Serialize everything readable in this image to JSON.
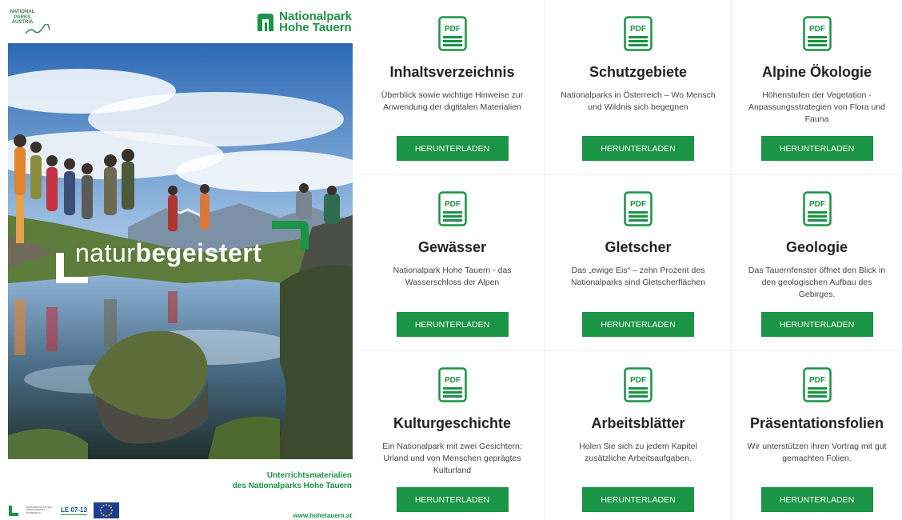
{
  "cover": {
    "npa_logo_text": "NATIONAL PARKS AUSTRIA",
    "brand_logo_line1": "Nationalpark",
    "brand_logo_line2": "Hohe Tauern",
    "tagline_light": "natur",
    "tagline_bold": "begeistert",
    "caption_line1": "Unterrichtsmaterialien",
    "caption_line2": "des Nationalparks Hohe Tauern",
    "partner_text": "MINISTERIUM FÜR EIN LEBENSWERTES ÖSTERREICH",
    "le_logo": "LE 07-13",
    "url": "www.hohetauern.at",
    "brand_color": "#1a9446"
  },
  "downloads": [
    {
      "icon": "pdf-icon",
      "icon_label": "PDF",
      "title": "Inhaltsverzeichnis",
      "description": "Überblick sowie wichtige Hinweise zur Anwendung der digtitalen Materialien",
      "button": "HERUNTERLADEN"
    },
    {
      "icon": "pdf-icon",
      "icon_label": "PDF",
      "title": "Schutzgebiete",
      "description": "Nationalparks in Österreich – Wo Mensch und Wildnis sich begegnen",
      "button": "HERUNTERLADEN"
    },
    {
      "icon": "pdf-icon",
      "icon_label": "PDF",
      "title": "Alpine Ökologie",
      "description": "Höhenstufen der Vegetation - Anpassungsstrategien von Flora und Fauna",
      "button": "HERUNTERLADEN"
    },
    {
      "icon": "pdf-icon",
      "icon_label": "PDF",
      "title": "Gewässer",
      "description": "Nationalpark Hohe Tauern -  das Wasserschloss der Alpen",
      "button": "HERUNTERLADEN"
    },
    {
      "icon": "pdf-icon",
      "icon_label": "PDF",
      "title": "Gletscher",
      "description": "Das „ewige Eis“ – zehn Prozent des Nationalparks sind Gletscherflächen",
      "button": "HERUNTERLADEN"
    },
    {
      "icon": "pdf-icon",
      "icon_label": "PDF",
      "title": "Geologie",
      "description": "Das Tauernfenster öffnet den Blick in den geologischen Aufbau des Gebirges.",
      "button": "HERUNTERLADEN"
    },
    {
      "icon": "pdf-icon",
      "icon_label": "PDF",
      "title": "Kulturgeschichte",
      "description": "Ein Nationalpark mit zwei Gesichtern: Urland und von Menschen geprägtes Kulturland",
      "button": "HERUNTERLADEN"
    },
    {
      "icon": "pdf-icon",
      "icon_label": "PDF",
      "title": "Arbeitsblätter",
      "description": "Holen Sie sich zu jedem Kapitel zusätzliche Arbeitsaufgaben.",
      "button": "HERUNTERLADEN"
    },
    {
      "icon": "pdf-icon",
      "icon_label": "PDF",
      "title": "Präsentationsfolien",
      "description": "Wir unterstützen ihren Vortrag mit gut gemachten Folien.",
      "button": "HERUNTERLADEN"
    }
  ]
}
